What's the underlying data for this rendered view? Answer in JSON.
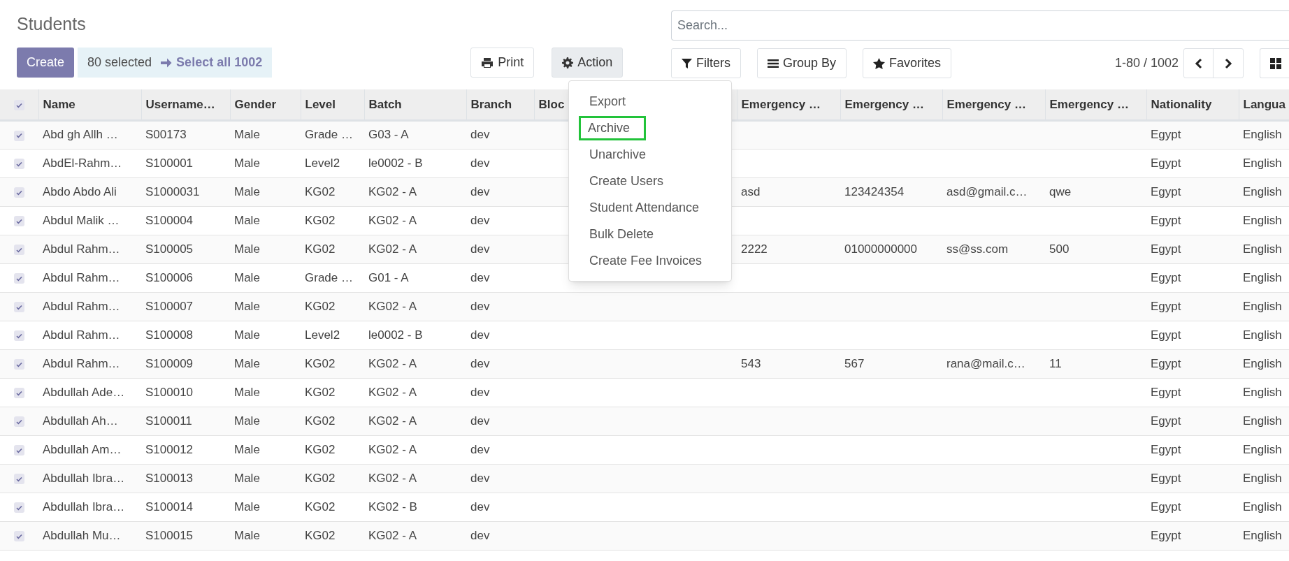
{
  "title": "Students",
  "create_button": "Create",
  "selection": {
    "count": "80 selected",
    "select_all": "Select all 1002"
  },
  "print_button": "Print",
  "action_button": {
    "label": "Action",
    "open": true
  },
  "action_menu": [
    {
      "label": "Export",
      "outlined": false
    },
    {
      "label": "Archive",
      "outlined": true
    },
    {
      "label": "Unarchive",
      "outlined": false
    },
    {
      "label": "Create Users",
      "outlined": false
    },
    {
      "label": "Student Attendance",
      "outlined": false
    },
    {
      "label": "Bulk Delete",
      "outlined": false
    },
    {
      "label": "Create Fee Invoices",
      "outlined": false
    }
  ],
  "search": {
    "placeholder": "Search..."
  },
  "filter_buttons": [
    {
      "kind": "filter",
      "label": "Filters"
    },
    {
      "kind": "group",
      "label": "Group By"
    },
    {
      "kind": "star",
      "label": "Favorites"
    }
  ],
  "pager": "1-80 / 1002",
  "table": {
    "all_checked": true,
    "columns": [
      "Name",
      "Username…",
      "Gender",
      "Level",
      "Batch",
      "Branch",
      "Bloc",
      "",
      "Emergency …",
      "Emergency …",
      "Emergency …",
      "Emergency …",
      "Nationality",
      "Langua"
    ],
    "rows": [
      {
        "checked": true,
        "cells": [
          "Abd gh Allh …",
          "S00173",
          "Male",
          "Grade …",
          "G03 - A",
          "dev",
          "",
          "",
          "",
          "",
          "",
          "",
          "Egypt",
          "English"
        ]
      },
      {
        "checked": true,
        "cells": [
          "AbdEl-Rahm…",
          "S100001",
          "Male",
          "Level2",
          "le0002 - B",
          "dev",
          "",
          "",
          "",
          "",
          "",
          "",
          "Egypt",
          "English"
        ]
      },
      {
        "checked": true,
        "cells": [
          "Abdo Abdo Ali",
          "S1000031",
          "Male",
          "KG02",
          "KG02 - A",
          "dev",
          "",
          "",
          "asd",
          "123424354",
          "asd@gmail.c…",
          "qwe",
          "Egypt",
          "English"
        ]
      },
      {
        "checked": true,
        "cells": [
          "Abdul Malik …",
          "S100004",
          "Male",
          "KG02",
          "KG02 - A",
          "dev",
          "",
          "",
          "",
          "",
          "",
          "",
          "Egypt",
          "English"
        ]
      },
      {
        "checked": true,
        "cells": [
          "Abdul Rahm…",
          "S100005",
          "Male",
          "KG02",
          "KG02 - A",
          "dev",
          "",
          "",
          "2222",
          "01000000000",
          "ss@ss.com",
          "500",
          "Egypt",
          "English"
        ]
      },
      {
        "checked": true,
        "cells": [
          "Abdul Rahm…",
          "S100006",
          "Male",
          "Grade …",
          "G01 - A",
          "dev",
          "",
          "",
          "",
          "",
          "",
          "",
          "Egypt",
          "English"
        ]
      },
      {
        "checked": true,
        "cells": [
          "Abdul Rahm…",
          "S100007",
          "Male",
          "KG02",
          "KG02 - A",
          "dev",
          "",
          "",
          "",
          "",
          "",
          "",
          "Egypt",
          "English"
        ]
      },
      {
        "checked": true,
        "cells": [
          "Abdul Rahm…",
          "S100008",
          "Male",
          "Level2",
          "le0002 - B",
          "dev",
          "",
          "",
          "",
          "",
          "",
          "",
          "Egypt",
          "English"
        ]
      },
      {
        "checked": true,
        "cells": [
          "Abdul Rahm…",
          "S100009",
          "Male",
          "KG02",
          "KG02 - A",
          "dev",
          "",
          "",
          "543",
          "567",
          "rana@mail.c…",
          "11",
          "Egypt",
          "English"
        ]
      },
      {
        "checked": true,
        "cells": [
          "Abdullah Ade…",
          "S100010",
          "Male",
          "KG02",
          "KG02 - A",
          "dev",
          "",
          "",
          "",
          "",
          "",
          "",
          "Egypt",
          "English"
        ]
      },
      {
        "checked": true,
        "cells": [
          "Abdullah Ah…",
          "S100011",
          "Male",
          "KG02",
          "KG02 - A",
          "dev",
          "",
          "",
          "",
          "",
          "",
          "",
          "Egypt",
          "English"
        ]
      },
      {
        "checked": true,
        "cells": [
          "Abdullah Am…",
          "S100012",
          "Male",
          "KG02",
          "KG02 - A",
          "dev",
          "",
          "",
          "",
          "",
          "",
          "",
          "Egypt",
          "English"
        ]
      },
      {
        "checked": true,
        "cells": [
          "Abdullah Ibra…",
          "S100013",
          "Male",
          "KG02",
          "KG02 - A",
          "dev",
          "",
          "",
          "",
          "",
          "",
          "",
          "Egypt",
          "English"
        ]
      },
      {
        "checked": true,
        "cells": [
          "Abdullah Ibra…",
          "S100014",
          "Male",
          "KG02",
          "KG02 - B",
          "dev",
          "",
          "",
          "",
          "",
          "",
          "",
          "Egypt",
          "English"
        ]
      },
      {
        "checked": true,
        "cells": [
          "Abdullah Mu…",
          "S100015",
          "Male",
          "KG02",
          "KG02 - A",
          "dev",
          "",
          "",
          "",
          "",
          "",
          "",
          "Egypt",
          "English"
        ]
      }
    ]
  }
}
